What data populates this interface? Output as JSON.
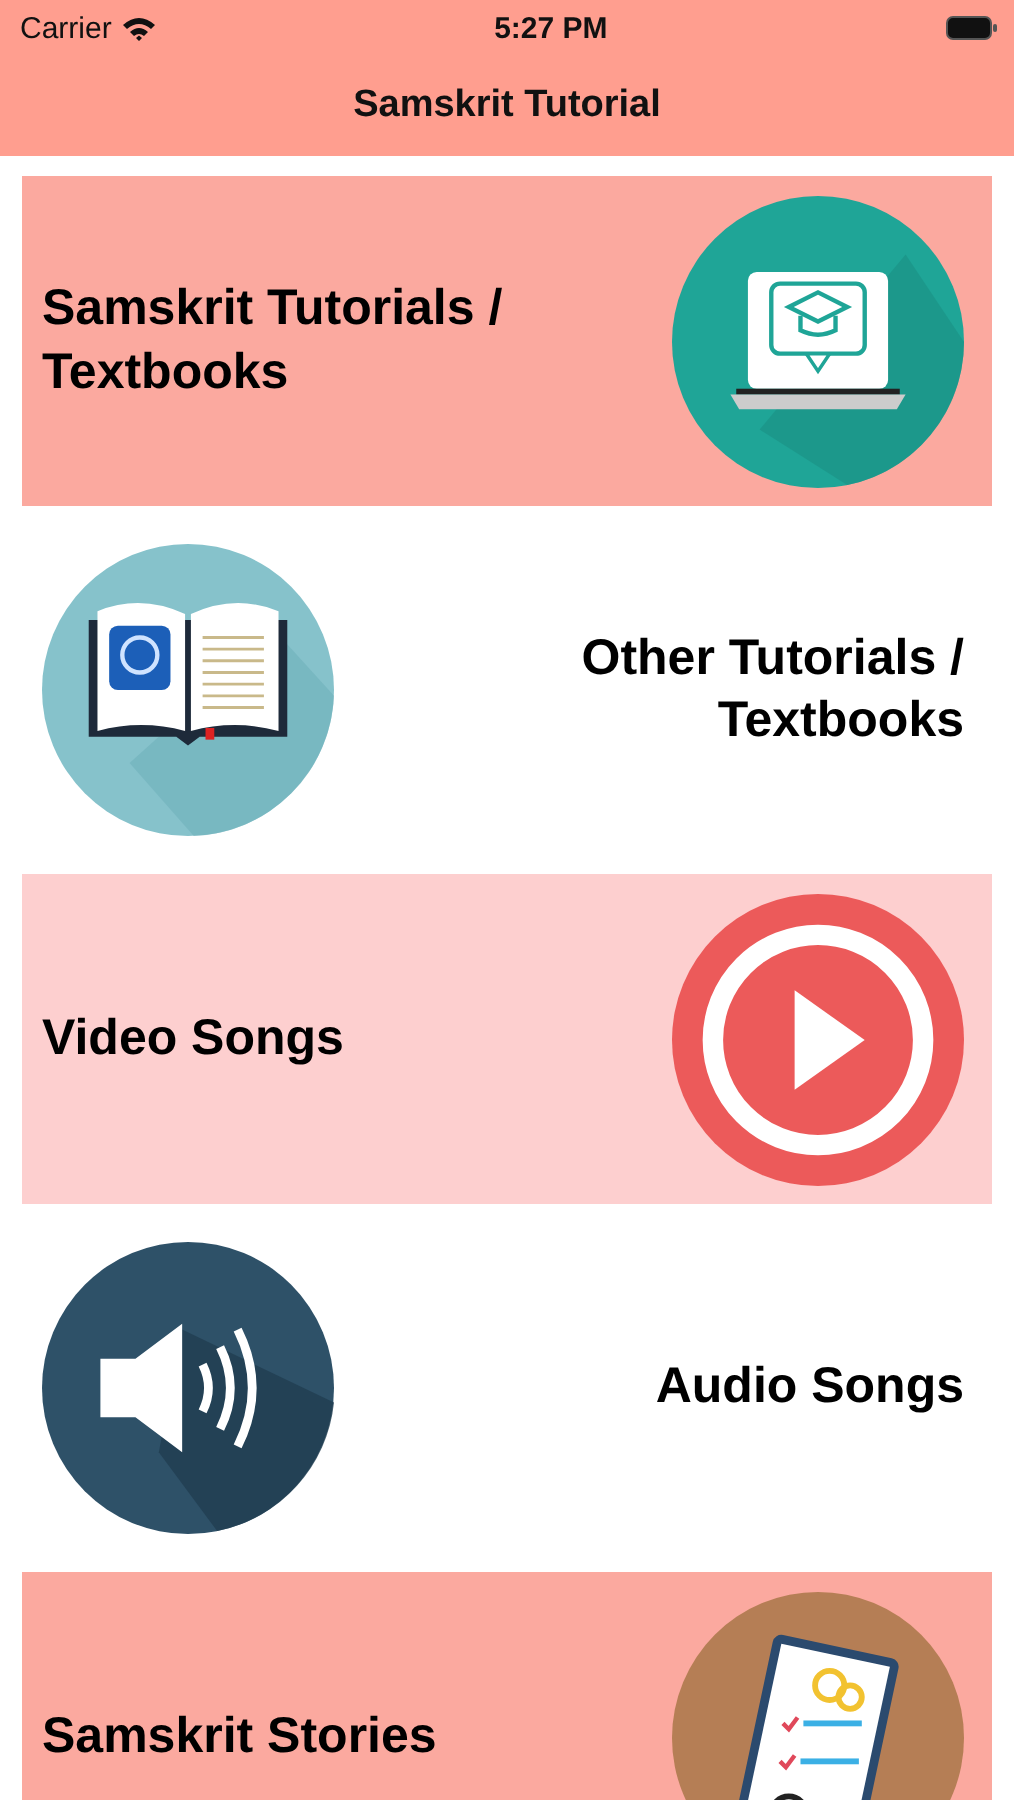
{
  "status_bar": {
    "carrier": "Carrier",
    "time": "5:27 PM"
  },
  "nav_bar": {
    "title": "Samskrit Tutorial"
  },
  "items": [
    {
      "label": "Samskrit Tutorials / Textbooks"
    },
    {
      "label": "Other Tutorials / Textbooks"
    },
    {
      "label": "Video Songs"
    },
    {
      "label": "Audio Songs"
    },
    {
      "label": "Samskrit Stories"
    }
  ]
}
